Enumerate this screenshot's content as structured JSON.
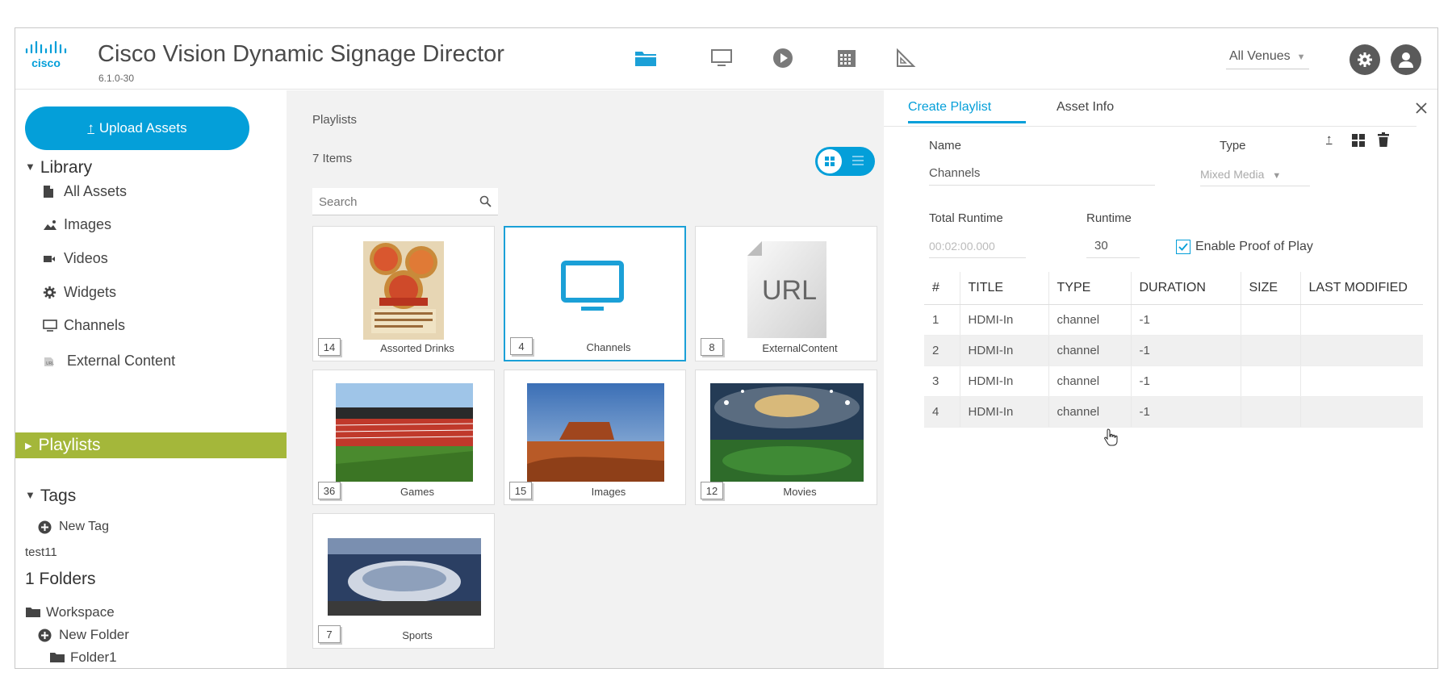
{
  "header": {
    "logo_text": "cisco",
    "title": "Cisco Vision Dynamic Signage Director",
    "version": "6.1.0-30",
    "venue_selector": "All Venues",
    "colors": {
      "accent": "#049fd9",
      "nav_active": "#1ba0d7",
      "nav_icon": "#7a7a7a"
    }
  },
  "nav_icons": [
    "folder-icon",
    "monitor-icon",
    "play-icon",
    "calendar-icon",
    "triangle-ruler-icon"
  ],
  "sidebar": {
    "upload_label": "Upload Assets",
    "library_label": "Library",
    "library_items": [
      {
        "label": "All Assets",
        "icon": "file-icon"
      },
      {
        "label": "Images",
        "icon": "image-icon"
      },
      {
        "label": "Videos",
        "icon": "video-icon"
      },
      {
        "label": "Widgets",
        "icon": "gear-icon"
      },
      {
        "label": "Channels",
        "icon": "monitor-icon"
      },
      {
        "label": "External Content",
        "icon": "external-icon"
      }
    ],
    "playlists_label": "Playlists",
    "tags_label": "Tags",
    "new_tag_label": "New Tag",
    "tag_items": [
      "test11"
    ],
    "folders_label": "1 Folders",
    "workspace_label": "Workspace",
    "new_folder_label": "New Folder",
    "folder_items": [
      "Folder1"
    ],
    "active_color": "#a4b73a"
  },
  "playlists": {
    "title": "Playlists",
    "count_label": "7 Items",
    "search_placeholder": "Search",
    "tiles": [
      {
        "name": "Assorted Drinks",
        "count": "14",
        "thumb": "pizza-box"
      },
      {
        "name": "Channels",
        "count": "4",
        "thumb": "monitor",
        "selected": true
      },
      {
        "name": "ExternalContent",
        "count": "8",
        "thumb": "url-doc",
        "thumb_text": "URL"
      },
      {
        "name": "Games",
        "count": "36",
        "thumb": "stadium"
      },
      {
        "name": "Images",
        "count": "15",
        "thumb": "desert"
      },
      {
        "name": "Movies",
        "count": "12",
        "thumb": "field-lights"
      },
      {
        "name": "Sports",
        "count": "7",
        "thumb": "arena"
      }
    ]
  },
  "panel": {
    "tabs": [
      "Create Playlist",
      "Asset Info"
    ],
    "name_label": "Name",
    "name_value": "Channels",
    "type_label": "Type",
    "type_value": "Mixed Media",
    "total_runtime_label": "Total Runtime",
    "total_runtime_value": "00:02:00.000",
    "runtime_label": "Runtime",
    "runtime_value": "30",
    "proof_label": "Enable Proof of Play",
    "proof_checked": true,
    "table": {
      "columns": [
        "#",
        "TITLE",
        "TYPE",
        "DURATION",
        "SIZE",
        "LAST MODIFIED"
      ],
      "rows": [
        [
          "1",
          "HDMI-In",
          "channel",
          "-1",
          "",
          ""
        ],
        [
          "2",
          "HDMI-In",
          "channel",
          "-1",
          "",
          ""
        ],
        [
          "3",
          "HDMI-In",
          "channel",
          "-1",
          "",
          ""
        ],
        [
          "4",
          "HDMI-In",
          "channel",
          "-1",
          "",
          ""
        ]
      ]
    }
  }
}
